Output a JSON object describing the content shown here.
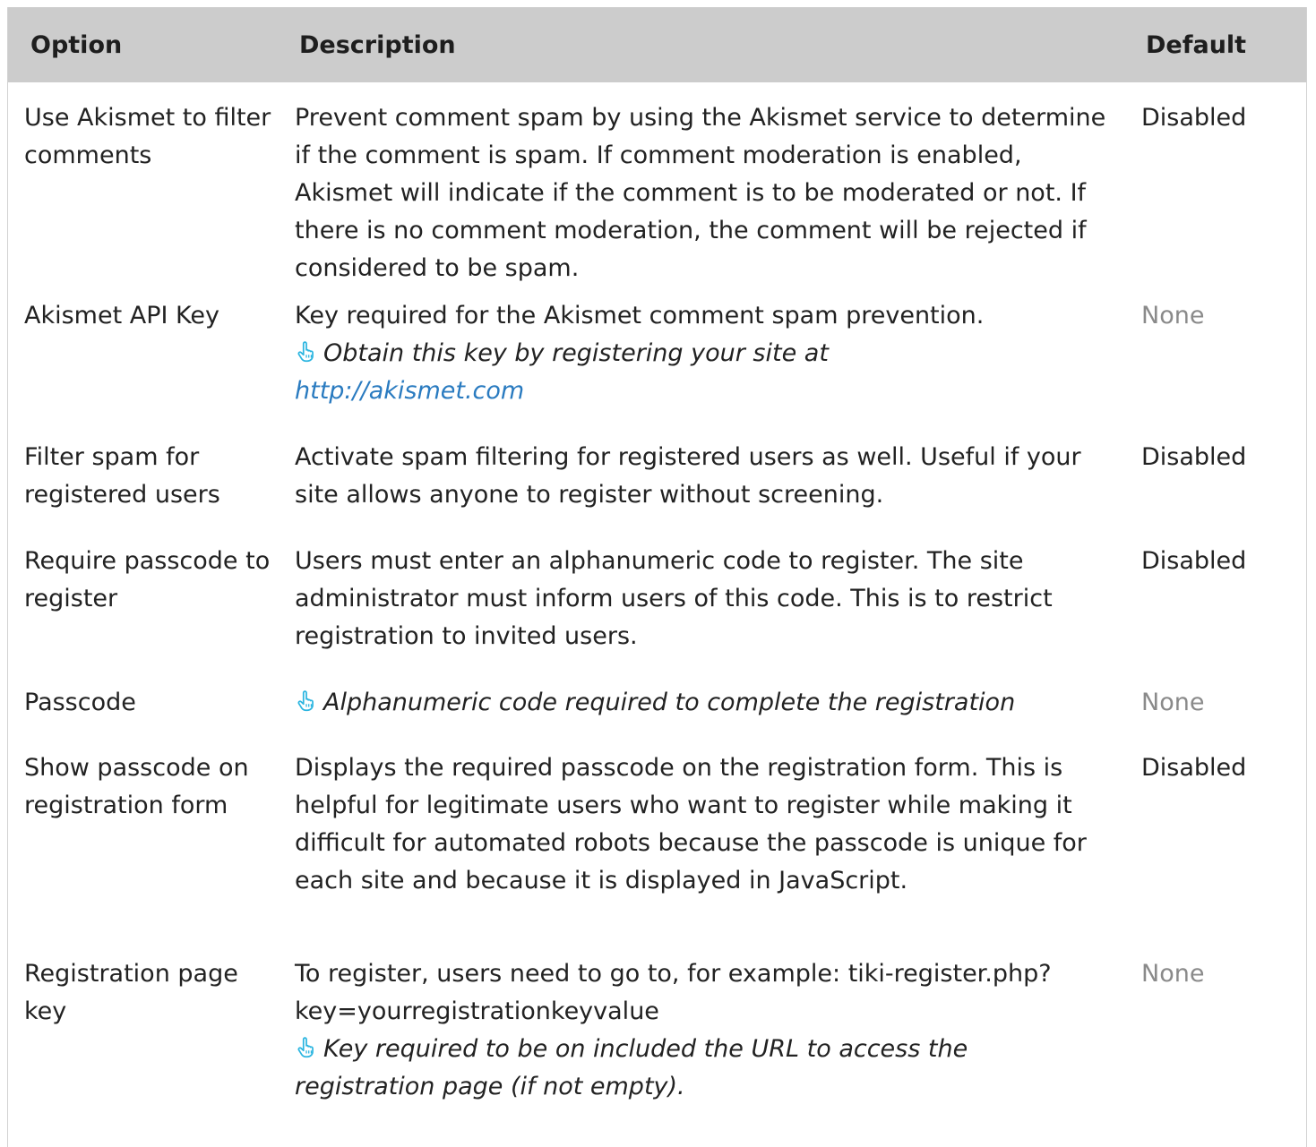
{
  "header": {
    "option": "Option",
    "description": "Description",
    "default": "Default"
  },
  "rows": [
    {
      "option": "Use Akismet to filter comments",
      "description": "Prevent comment spam by using the Akismet service to determine if the comment is spam. If comment moderation is enabled, Akismet will indicate if the comment is to be moderated or not. If there is no comment moderation, the comment will be rejected if considered to be spam.",
      "default": "Disabled"
    },
    {
      "option": "Akismet API Key",
      "description": "Key required for the Akismet comment spam prevention.",
      "hint": "Obtain this key by registering your site at",
      "link": "http://akismet.com",
      "default": "None"
    },
    {
      "option": "Filter spam for registered users",
      "description": "Activate spam filtering for registered users as well. Useful if your site allows anyone to register without screening.",
      "default": "Disabled"
    },
    {
      "option": "Require passcode to register",
      "description": "Users must enter an alphanumeric code to register. The site administrator must inform users of this code. This is to restrict registration to invited users.",
      "default": "Disabled"
    },
    {
      "option": "Passcode",
      "hint": "Alphanumeric code required to complete the registration",
      "default": "None"
    },
    {
      "option": "Show passcode on registration form",
      "description": "Displays the required passcode on the registration form. This is helpful for legitimate users who want to register while making it difficult for automated robots because the passcode is unique for each site and because it is displayed in JavaScript.",
      "default": "Disabled"
    },
    {
      "option": "Registration page key",
      "description": "To register, users need to go to, for example: tiki-register.php?key=yourregistrationkeyvalue",
      "hint": "Key required to be on included the URL to access the registration page (if not empty).",
      "default": "None"
    }
  ],
  "colors": {
    "header_bg": "#cccccc",
    "muted_text": "#8a8a8a",
    "link": "#2a7bc0",
    "hint_icon": "#2bb5e0"
  },
  "icons": {
    "hint": "pointing-hand-icon"
  }
}
